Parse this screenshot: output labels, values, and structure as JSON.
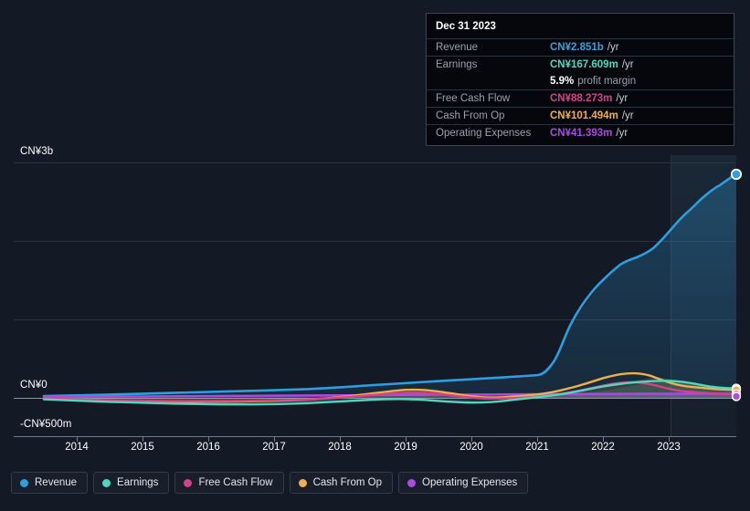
{
  "tooltip": {
    "title": "Dec 31 2023",
    "rows": [
      {
        "key": "Revenue",
        "value": "CN¥2.851b",
        "unit": "/yr",
        "color": "#3aa0dc"
      },
      {
        "key": "Earnings",
        "value": "CN¥167.609m",
        "unit": "/yr",
        "color": "#4fd8c0"
      },
      {
        "key": "",
        "value": "5.9%",
        "unit": "profit margin",
        "color": "#ffffff",
        "sub": true
      },
      {
        "key": "Free Cash Flow",
        "value": "CN¥88.273m",
        "unit": "/yr",
        "color": "#d6418c"
      },
      {
        "key": "Cash From Op",
        "value": "CN¥101.494m",
        "unit": "/yr",
        "color": "#eeb04e"
      },
      {
        "key": "Operating Expenses",
        "value": "CN¥41.393m",
        "unit": "/yr",
        "color": "#a94ce0"
      }
    ]
  },
  "legend": {
    "items": [
      {
        "label": "Revenue",
        "color": "#2f9ee0"
      },
      {
        "label": "Earnings",
        "color": "#4fd8c0"
      },
      {
        "label": "Free Cash Flow",
        "color": "#d6418c"
      },
      {
        "label": "Cash From Op",
        "color": "#eeb04e"
      },
      {
        "label": "Operating Expenses",
        "color": "#a94ce0"
      }
    ]
  },
  "axes": {
    "y_top_label": "CN¥3b",
    "y_zero_label": "CN¥0",
    "y_bottom_label": "-CN¥500m",
    "x_labels": [
      "2014",
      "2015",
      "2016",
      "2017",
      "2018",
      "2019",
      "2020",
      "2021",
      "2022",
      "2023"
    ]
  },
  "chart_data": {
    "type": "area",
    "title": "",
    "subtitle": "",
    "xlabel": "",
    "ylabel": "CN¥",
    "ylim": [
      -500000000,
      3000000000
    ],
    "ytick_values": [
      3000000000,
      2000000000,
      1000000000,
      0,
      -500000000
    ],
    "ytick_labels": [
      "CN¥3b",
      "",
      "",
      "CN¥0",
      "-CN¥500m"
    ],
    "grid": true,
    "legend_position": "bottom",
    "x_unit": "year",
    "x": [
      2013.5,
      2014,
      2014.5,
      2015,
      2015.5,
      2016,
      2016.5,
      2017,
      2017.5,
      2018,
      2018.5,
      2019,
      2019.5,
      2020,
      2020.5,
      2021,
      2021.5,
      2022,
      2022.5,
      2023,
      2023.5,
      2024
    ],
    "series": [
      {
        "name": "Revenue",
        "color": "#2f9ee0",
        "units": "CN¥",
        "values": [
          28000000,
          32000000,
          38000000,
          45000000,
          52000000,
          58000000,
          66000000,
          74000000,
          82000000,
          95000000,
          110000000,
          128000000,
          150000000,
          168000000,
          190000000,
          215000000,
          900000000,
          1450000000,
          1780000000,
          2080000000,
          2480000000,
          2851000000
        ],
        "last_value": 2851000000,
        "last_label": "CN¥2.851b"
      },
      {
        "name": "Earnings",
        "color": "#4fd8c0",
        "units": "CN¥",
        "values": [
          -5000000,
          -8000000,
          -12000000,
          -18000000,
          -28000000,
          -40000000,
          -48000000,
          -52000000,
          -50000000,
          -42000000,
          -30000000,
          -18000000,
          -22000000,
          -30000000,
          -25000000,
          -10000000,
          15000000,
          60000000,
          120000000,
          170000000,
          160000000,
          167609000
        ],
        "last_value": 167609000,
        "last_label": "CN¥167.609m"
      },
      {
        "name": "Free Cash Flow",
        "color": "#d6418c",
        "units": "CN¥",
        "values": [
          -2000000,
          -4000000,
          -6000000,
          -10000000,
          -14000000,
          -18000000,
          -22000000,
          -24000000,
          -20000000,
          -10000000,
          8000000,
          30000000,
          38000000,
          20000000,
          5000000,
          -2000000,
          10000000,
          45000000,
          95000000,
          125000000,
          100000000,
          88273000
        ],
        "last_value": 88273000,
        "last_label": "CN¥88.273m"
      },
      {
        "name": "Cash From Op",
        "color": "#eeb04e",
        "units": "CN¥",
        "values": [
          -3000000,
          -5000000,
          -8000000,
          -12000000,
          -16000000,
          -20000000,
          -24000000,
          -26000000,
          -22000000,
          -8000000,
          14000000,
          42000000,
          52000000,
          32000000,
          14000000,
          6000000,
          22000000,
          60000000,
          115000000,
          150000000,
          118000000,
          101494000
        ],
        "last_value": 101494000,
        "last_label": "CN¥101.494m"
      },
      {
        "name": "Operating Expenses",
        "color": "#a94ce0",
        "units": "CN¥",
        "values": [
          4000000,
          5000000,
          6000000,
          8000000,
          10000000,
          12000000,
          14000000,
          16000000,
          18000000,
          20000000,
          22000000,
          25000000,
          27000000,
          28000000,
          29000000,
          30000000,
          31000000,
          33000000,
          36000000,
          39000000,
          40000000,
          41393000
        ],
        "last_value": 41393000,
        "last_label": "CN¥41.393m"
      }
    ],
    "forecast_band": {
      "start_x": 2023.0,
      "end_x": 2024.0,
      "label": ""
    }
  }
}
